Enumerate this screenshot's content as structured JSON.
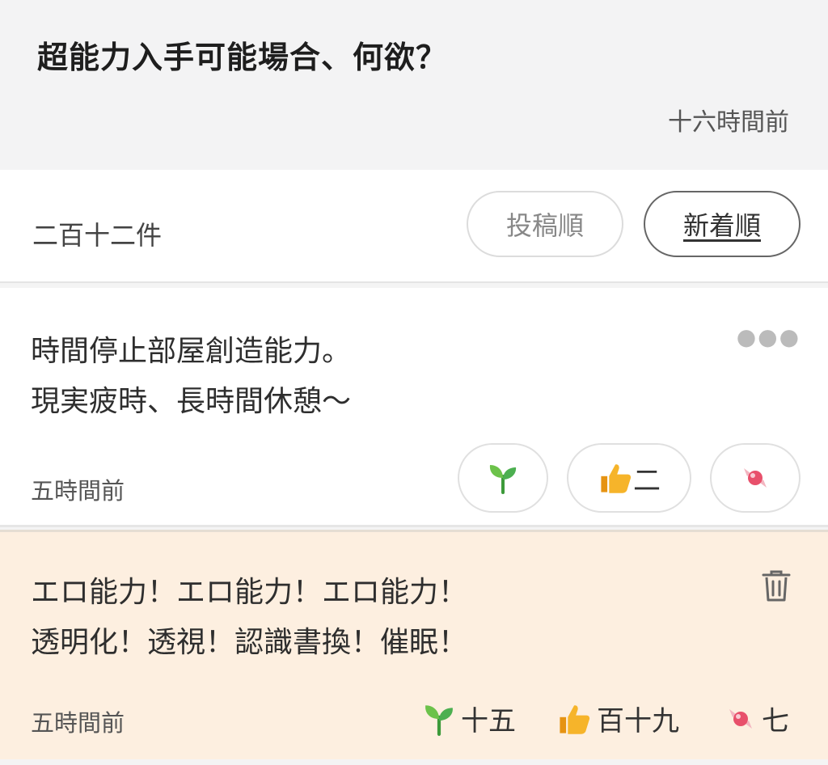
{
  "header": {
    "title": "超能力入手可能場合、何欲？",
    "time": "十六時間前"
  },
  "toolbar": {
    "count": "二百十二件",
    "sort_post": "投稿順",
    "sort_new": "新着順"
  },
  "comments": [
    {
      "lines": [
        "時間停止部屋創造能力。",
        "現実疲時、長時間休憩～"
      ],
      "time": "五時間前",
      "menu_icon": "more-icon",
      "reactions": {
        "sprout": "",
        "like": "二",
        "candy": ""
      }
    },
    {
      "lines": [
        "エロ能力！エロ能力！エロ能力！",
        "透明化！透視！認識書換！催眠！"
      ],
      "time": "五時間前",
      "menu_icon": "trash-icon",
      "reactions": {
        "sprout": "十五",
        "like": "百十九",
        "candy": "七"
      }
    }
  ],
  "colors": {
    "highlight_bg": "#fdefe0",
    "sprout": "#4caf50",
    "like": "#f5a623",
    "candy": "#e8506b"
  }
}
